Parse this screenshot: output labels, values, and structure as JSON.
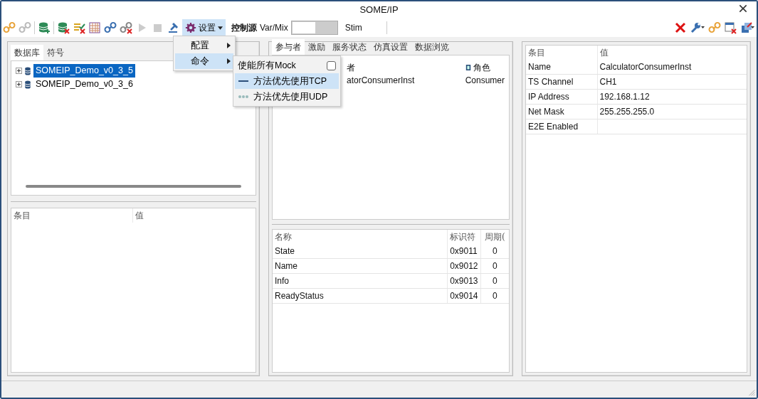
{
  "window": {
    "title": "SOME/IP"
  },
  "toolbar": {
    "settings_label": "设置",
    "control_source_label": "控制源",
    "switch_left_label": "Var/Mix",
    "switch": {
      "on": false
    },
    "switch_right_label": "Stim"
  },
  "settings_menu": {
    "items": [
      {
        "label": "配置",
        "selected": false
      },
      {
        "label": "命令",
        "selected": true
      }
    ]
  },
  "command_submenu": {
    "items": [
      {
        "kind": "checkbox",
        "label": "使能所有Mock",
        "checked": false,
        "selected": false
      },
      {
        "kind": "option",
        "label": "方法优先使用TCP",
        "selected": true
      },
      {
        "kind": "option",
        "label": "方法优先使用UDP",
        "selected": false
      }
    ]
  },
  "left_panel": {
    "tabs": [
      {
        "label": "数据库",
        "selected": true
      },
      {
        "label": "符号",
        "selected": false
      }
    ],
    "tree": [
      {
        "label": "SOMEIP_Demo_v0_3_5",
        "selected": true,
        "expanded": false
      },
      {
        "label": "SOMEIP_Demo_v0_3_6",
        "selected": false,
        "expanded": false
      }
    ],
    "properties": {
      "columns": [
        "条目",
        "值"
      ]
    }
  },
  "middle_panel": {
    "tabs": [
      {
        "label": "参与者",
        "selected": true
      },
      {
        "label": "激励",
        "selected": false
      },
      {
        "label": "服务状态",
        "selected": false
      },
      {
        "label": "仿真设置",
        "selected": false
      },
      {
        "label": "数据浏览",
        "selected": false
      }
    ],
    "participants": {
      "columns": [
        "者",
        "角色"
      ],
      "rows": [
        [
          "atorConsumerInst",
          "Consumer"
        ]
      ]
    },
    "signals": {
      "columns": [
        "名称",
        "标识符",
        "周期("
      ],
      "rows": [
        [
          "State",
          "0x9011",
          "0"
        ],
        [
          "Name",
          "0x9012",
          "0"
        ],
        [
          "Info",
          "0x9013",
          "0"
        ],
        [
          "ReadyStatus",
          "0x9014",
          "0"
        ]
      ]
    }
  },
  "right_panel": {
    "columns": [
      "条目",
      "值"
    ],
    "rows": [
      [
        "Name",
        "CalculatorConsumerInst"
      ],
      [
        "TS Channel",
        "CH1"
      ],
      [
        "IP Address",
        "192.168.1.12"
      ],
      [
        "Net Mask",
        "255.255.255.0"
      ],
      [
        "E2E Enabled",
        ""
      ]
    ]
  }
}
